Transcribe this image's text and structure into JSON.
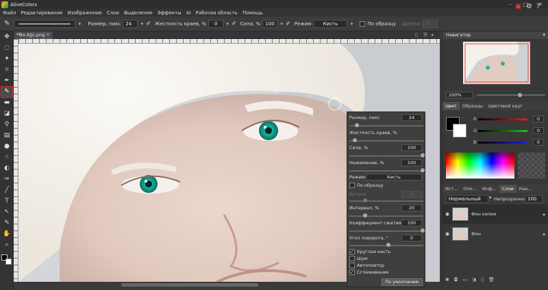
{
  "app": {
    "title": "AliveColors",
    "window_controls": [
      "–",
      "□",
      "✕"
    ]
  },
  "menu": [
    "Файл",
    "Редактирование",
    "Изображение",
    "Слои",
    "Выделение",
    "Эффекты",
    "AI",
    "Рабочая область",
    "Помощь"
  ],
  "options": {
    "size_label": "Размер, пикс",
    "size_value": "24",
    "hardness_label": "Жесткость краев, %",
    "hardness_value": "0",
    "strength_label": "Сила, %",
    "strength_value": "100",
    "mode_label": "Режим",
    "mode_value": "Кисть",
    "sample_label": "По образцу",
    "tolerance_label": "Допуск",
    "tolerance_value": "20"
  },
  "document": {
    "tab_label": "*fkn,bjjc.png"
  },
  "brush_panel": {
    "size_label": "Размер, пикс",
    "size_value": "24",
    "hardness_label": "Жесткость краев, %",
    "hardness_value": "0",
    "strength_label": "Сила, %",
    "strength_value": "100",
    "pressure_label": "Нажимание, %",
    "pressure_value": "100",
    "mode_label": "Режим",
    "mode_value": "Кисть",
    "sample_label": "По образцу",
    "tolerance_label": "Допуск",
    "tolerance_value": "20",
    "interval_label": "Интервал, %",
    "interval_value": "20",
    "compress_label": "Коэффициент сжатия, %",
    "compress_value": "100",
    "angle_label": "Угол поворота, °",
    "angle_value": "0",
    "round_label": "Круглая кисть",
    "round_checked": true,
    "noise_label": "Шум",
    "noise_checked": false,
    "auto_label": "Автоповтор",
    "auto_checked": false,
    "smooth_label": "Сглаживание",
    "smooth_checked": true,
    "default_button": "По умолчанию"
  },
  "navigator": {
    "title": "Навигатор",
    "zoom": "200%"
  },
  "color_tabs": [
    "Цвет",
    "Образцы",
    "Цветовой круг"
  ],
  "channels": [
    {
      "label": "R",
      "value": "0",
      "color": "#e02020"
    },
    {
      "label": "G",
      "value": "0",
      "color": "#20c020"
    },
    {
      "label": "B",
      "value": "0",
      "color": "#2020e0"
    }
  ],
  "layer_tabs": [
    "Ист...",
    "Опе...",
    "Инф...",
    "Слои",
    "Кан..."
  ],
  "layers": {
    "blend_mode": "Нормальный",
    "opacity_label": "Непрозрачность",
    "opacity_value": "100",
    "items": [
      {
        "name": "Фон копия",
        "selected": true
      },
      {
        "name": "Фон",
        "selected": false
      }
    ]
  },
  "colors": {
    "accent_red": "#e02828",
    "eye": "#1ec9a8"
  }
}
